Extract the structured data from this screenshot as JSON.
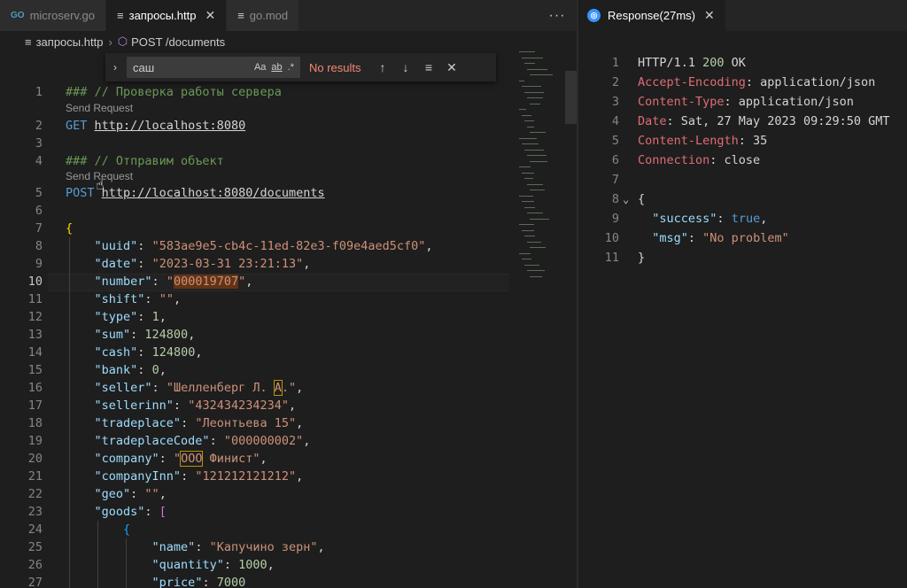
{
  "tabs_left": [
    {
      "icon": "GO",
      "label": "microserv.go",
      "active": false
    },
    {
      "icon": "≡",
      "label": "запросы.http",
      "active": true
    },
    {
      "icon": "≡",
      "label": "go.mod",
      "active": false
    }
  ],
  "tabs_more": "···",
  "response_tab": {
    "label": "Response(27ms)",
    "close": "✕"
  },
  "breadcrumb": {
    "file": "запросы.http",
    "symbol": "POST /documents"
  },
  "find": {
    "query": "саш",
    "opt_case": "Aa",
    "opt_word": "ab",
    "opt_regex": ".*",
    "status": "No results",
    "prev": "↑",
    "next": "↓",
    "sel": "≡",
    "close": "✕"
  },
  "code_lens": "Send Request",
  "editor_lines": [
    {
      "n": "1",
      "parts": [
        [
          "c-comment",
          "### // Проверка работы сервера"
        ]
      ]
    },
    {
      "n": "2",
      "parts": [
        [
          "c-method",
          "GET "
        ],
        [
          "c-url",
          "http://localhost:8080"
        ]
      ]
    },
    {
      "n": "3",
      "parts": []
    },
    {
      "n": "4",
      "parts": [
        [
          "c-comment",
          "### // Отправим объект"
        ]
      ]
    },
    {
      "n": "5",
      "parts": [
        [
          "c-method",
          "POST "
        ],
        [
          "c-url",
          "http://localhost:8080/documents"
        ]
      ]
    },
    {
      "n": "6",
      "parts": []
    },
    {
      "n": "7",
      "parts": [
        [
          "c-brace",
          "{"
        ]
      ]
    },
    {
      "n": "8",
      "parts": [
        [
          "",
          "    "
        ],
        [
          "c-key",
          "\"uuid\""
        ],
        [
          "",
          ": "
        ],
        [
          "c-str",
          "\"583ae9e5-cb4c-11ed-82e3-f09e4aed5cf0\""
        ],
        [
          "",
          ","
        ]
      ]
    },
    {
      "n": "9",
      "parts": [
        [
          "",
          "    "
        ],
        [
          "c-key",
          "\"date\""
        ],
        [
          "",
          ": "
        ],
        [
          "c-str",
          "\"2023-03-31 23:21:13\""
        ],
        [
          "",
          ","
        ]
      ]
    },
    {
      "n": "10",
      "parts": [
        [
          "",
          "    "
        ],
        [
          "c-key",
          "\"number\""
        ],
        [
          "",
          ": "
        ],
        [
          "c-str",
          "\""
        ],
        [
          "c-str hl",
          "000019707"
        ],
        [
          "c-str",
          "\""
        ],
        [
          "",
          ","
        ]
      ]
    },
    {
      "n": "11",
      "parts": [
        [
          "",
          "    "
        ],
        [
          "c-key",
          "\"shift\""
        ],
        [
          "",
          ": "
        ],
        [
          "c-str",
          "\"\""
        ],
        [
          "",
          ","
        ]
      ]
    },
    {
      "n": "12",
      "parts": [
        [
          "",
          "    "
        ],
        [
          "c-key",
          "\"type\""
        ],
        [
          "",
          ": "
        ],
        [
          "c-num",
          "1"
        ],
        [
          "",
          ","
        ]
      ]
    },
    {
      "n": "13",
      "parts": [
        [
          "",
          "    "
        ],
        [
          "c-key",
          "\"sum\""
        ],
        [
          "",
          ": "
        ],
        [
          "c-num",
          "124800"
        ],
        [
          "",
          ","
        ]
      ]
    },
    {
      "n": "14",
      "parts": [
        [
          "",
          "    "
        ],
        [
          "c-key",
          "\"cash\""
        ],
        [
          "",
          ": "
        ],
        [
          "c-num",
          "124800"
        ],
        [
          "",
          ","
        ]
      ]
    },
    {
      "n": "15",
      "parts": [
        [
          "",
          "    "
        ],
        [
          "c-key",
          "\"bank\""
        ],
        [
          "",
          ": "
        ],
        [
          "c-num",
          "0"
        ],
        [
          "",
          ","
        ]
      ]
    },
    {
      "n": "16",
      "parts": [
        [
          "",
          "    "
        ],
        [
          "c-key",
          "\"seller\""
        ],
        [
          "",
          ": "
        ],
        [
          "c-str",
          "\"Шелленберг Л. "
        ],
        [
          "c-str hlbox",
          "А"
        ],
        [
          "c-str",
          ".\""
        ],
        [
          "",
          ","
        ]
      ]
    },
    {
      "n": "17",
      "parts": [
        [
          "",
          "    "
        ],
        [
          "c-key",
          "\"sellerinn\""
        ],
        [
          "",
          ": "
        ],
        [
          "c-str",
          "\"432434234234\""
        ],
        [
          "",
          ","
        ]
      ]
    },
    {
      "n": "18",
      "parts": [
        [
          "",
          "    "
        ],
        [
          "c-key",
          "\"tradeplace\""
        ],
        [
          "",
          ": "
        ],
        [
          "c-str",
          "\"Леонтьева 15\""
        ],
        [
          "",
          ","
        ]
      ]
    },
    {
      "n": "19",
      "parts": [
        [
          "",
          "    "
        ],
        [
          "c-key",
          "\"tradeplaceCode\""
        ],
        [
          "",
          ": "
        ],
        [
          "c-str",
          "\"000000002\""
        ],
        [
          "",
          ","
        ]
      ]
    },
    {
      "n": "20",
      "parts": [
        [
          "",
          "    "
        ],
        [
          "c-key",
          "\"company\""
        ],
        [
          "",
          ": "
        ],
        [
          "c-str",
          "\""
        ],
        [
          "c-str hlbox",
          "ООО"
        ],
        [
          "c-str",
          " Финист\""
        ],
        [
          "",
          ","
        ]
      ]
    },
    {
      "n": "21",
      "parts": [
        [
          "",
          "    "
        ],
        [
          "c-key",
          "\"companyInn\""
        ],
        [
          "",
          ": "
        ],
        [
          "c-str",
          "\"121212121212\""
        ],
        [
          "",
          ","
        ]
      ]
    },
    {
      "n": "22",
      "parts": [
        [
          "",
          "    "
        ],
        [
          "c-key",
          "\"geo\""
        ],
        [
          "",
          ": "
        ],
        [
          "c-str",
          "\"\""
        ],
        [
          "",
          ","
        ]
      ]
    },
    {
      "n": "23",
      "parts": [
        [
          "",
          "    "
        ],
        [
          "c-key",
          "\"goods\""
        ],
        [
          "",
          ": "
        ],
        [
          "c-bracket",
          "["
        ]
      ]
    },
    {
      "n": "24",
      "parts": [
        [
          "",
          "        "
        ],
        [
          "c-brace2",
          "{"
        ]
      ]
    },
    {
      "n": "25",
      "parts": [
        [
          "",
          "            "
        ],
        [
          "c-key",
          "\"name\""
        ],
        [
          "",
          ": "
        ],
        [
          "c-str",
          "\"Капучино зерн\""
        ],
        [
          "",
          ","
        ]
      ]
    },
    {
      "n": "26",
      "parts": [
        [
          "",
          "            "
        ],
        [
          "c-key",
          "\"quantity\""
        ],
        [
          "",
          ": "
        ],
        [
          "c-num",
          "1000"
        ],
        [
          "",
          ","
        ]
      ]
    },
    {
      "n": "27",
      "parts": [
        [
          "",
          "            "
        ],
        [
          "c-key",
          "\"price\""
        ],
        [
          "",
          ": "
        ],
        [
          "c-num",
          "7000"
        ]
      ]
    }
  ],
  "response_lines": [
    {
      "n": "1",
      "parts": [
        [
          "",
          "HTTP/1.1 "
        ],
        [
          "c-num",
          "200"
        ],
        [
          "",
          " OK"
        ]
      ]
    },
    {
      "n": "2",
      "parts": [
        [
          "hdr",
          "Accept-Encoding"
        ],
        [
          "",
          ": application/json"
        ]
      ]
    },
    {
      "n": "3",
      "parts": [
        [
          "hdr",
          "Content-Type"
        ],
        [
          "",
          ": application/json"
        ]
      ]
    },
    {
      "n": "4",
      "parts": [
        [
          "hdr",
          "Date"
        ],
        [
          "",
          ": Sat, 27 May 2023 09:29:50 GMT"
        ]
      ]
    },
    {
      "n": "5",
      "parts": [
        [
          "hdr",
          "Content-Length"
        ],
        [
          "",
          ": 35"
        ]
      ]
    },
    {
      "n": "6",
      "parts": [
        [
          "hdr",
          "Connection"
        ],
        [
          "",
          ": close"
        ]
      ]
    },
    {
      "n": "7",
      "parts": []
    },
    {
      "n": "8",
      "parts": [
        [
          "",
          "{"
        ]
      ],
      "fold": "⌄"
    },
    {
      "n": "9",
      "parts": [
        [
          "",
          "  "
        ],
        [
          "c-key",
          "\"success\""
        ],
        [
          "",
          ": "
        ],
        [
          "r-blue",
          "true"
        ],
        [
          "",
          ","
        ]
      ]
    },
    {
      "n": "10",
      "parts": [
        [
          "",
          "  "
        ],
        [
          "c-key",
          "\"msg\""
        ],
        [
          "",
          ": "
        ],
        [
          "c-str",
          "\"No problem\""
        ]
      ]
    },
    {
      "n": "11",
      "parts": [
        [
          "",
          "}"
        ]
      ]
    }
  ],
  "colors": {
    "accent_response_icon": "#3794ff",
    "find_no_results": "#f48771"
  }
}
